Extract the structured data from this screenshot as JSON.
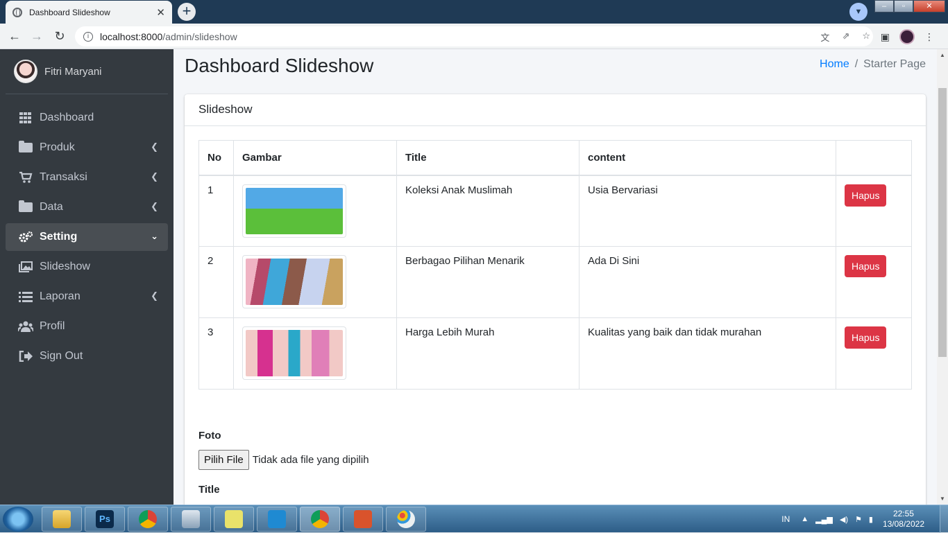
{
  "browser": {
    "tab_title": "Dashboard Slideshow",
    "tab_close": "✕",
    "new_tab": "+",
    "url_host": "localhost:8000",
    "url_path": "/admin/slideshow"
  },
  "sidebar": {
    "user_name": "Fitri Maryani",
    "items": [
      {
        "label": "Dashboard",
        "icon": "dashboard-grid-icon",
        "has_children": false,
        "active": false
      },
      {
        "label": "Produk",
        "icon": "folder-open-icon",
        "has_children": true,
        "active": false
      },
      {
        "label": "Transaksi",
        "icon": "cart-icon",
        "has_children": true,
        "active": false
      },
      {
        "label": "Data",
        "icon": "folder-icon",
        "has_children": true,
        "active": false
      },
      {
        "label": "Setting",
        "icon": "gears-icon",
        "has_children": true,
        "active": true
      },
      {
        "label": "Slideshow",
        "icon": "images-icon",
        "has_children": false,
        "active": false
      },
      {
        "label": "Laporan",
        "icon": "list-icon",
        "has_children": true,
        "active": false
      },
      {
        "label": "Profil",
        "icon": "users-icon",
        "has_children": false,
        "active": false
      },
      {
        "label": "Sign Out",
        "icon": "sign-out-icon",
        "has_children": false,
        "active": false
      }
    ]
  },
  "header": {
    "title": "Dashboard Slideshow",
    "breadcrumb_home": "Home",
    "breadcrumb_sep": "/",
    "breadcrumb_current": "Starter Page"
  },
  "card": {
    "title": "Slideshow",
    "columns": [
      "No",
      "Gambar",
      "Title",
      "content",
      ""
    ],
    "rows": [
      {
        "no": "1",
        "title": "Koleksi Anak Muslimah",
        "content": "Usia Bervariasi",
        "action": "Hapus"
      },
      {
        "no": "2",
        "title": "Berbagao Pilihan Menarik",
        "content": "Ada Di Sini",
        "action": "Hapus"
      },
      {
        "no": "3",
        "title": "Harga Lebih Murah",
        "content": "Kualitas yang baik dan tidak murahan",
        "action": "Hapus"
      }
    ]
  },
  "form": {
    "foto_label": "Foto",
    "file_button": "Pilih File",
    "file_status": "Tidak ada file yang dipilih",
    "title_label": "Title"
  },
  "taskbar": {
    "lang": "IN",
    "time": "22:55",
    "date": "13/08/2022"
  },
  "colors": {
    "sidebar_bg": "#343a40",
    "content_bg": "#f4f6f9",
    "link": "#007bff",
    "danger": "#dc3545"
  }
}
